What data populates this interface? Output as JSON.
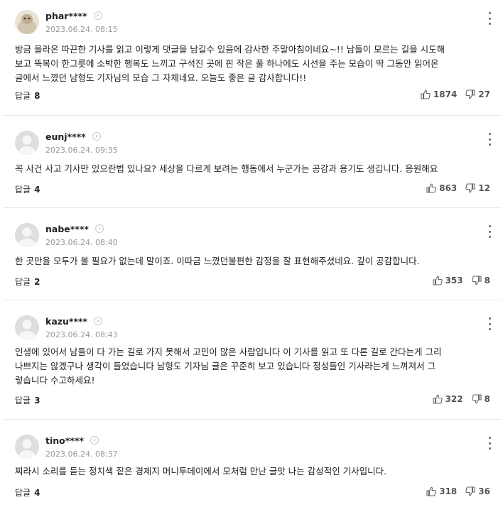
{
  "labels": {
    "reply": "답글"
  },
  "comments": [
    {
      "nickname": "phar****",
      "date": "2023.06.24. 08:15",
      "text": "방금 올라온 따끈한 기사를 읽고 이렇게 댓글을 남길수 있음에 감사한 주말아침이네요~!! 남들이 모르는 길을 시도해\n보고 뚝복이 한그릇에 소박한 행복도 느끼고 구석진 곳에 핀 작은 풀 하나에도 시선을 주는 모습이 딱 그동안 읽어온\n글에서 느꼈던 남형도 기자님의 모습 그 자체네요. 오늘도 좋은 글 감사합니다!!",
      "replies": "8",
      "likes": "1874",
      "dislikes": "27"
    },
    {
      "nickname": "eunj****",
      "date": "2023.06.24. 09:35",
      "text": "꼭 사건 사고 기사만 있으란법 있나요? 세상을 다르게 보려는 행동에서 누군가는 공감과 용기도 생깁니다. 응원해요",
      "replies": "4",
      "likes": "863",
      "dislikes": "12"
    },
    {
      "nickname": "nabe****",
      "date": "2023.06.24. 08:40",
      "text": "한 곳만을 모두가 볼 필요가 없는데 말이죠. 이따금 느꼈던불편한 감정을 잘 표현해주셨네요. 깊이 공감합니다.",
      "replies": "2",
      "likes": "353",
      "dislikes": "8"
    },
    {
      "nickname": "kazu****",
      "date": "2023.06.24. 08:43",
      "text": "인생에 있어서 남들이 다 가는 길로 가지 못해서 고민이 많은 사람입니다 이 기사를 읽고 또 다른 길로 간다는게 그리\n나쁘지는 않겠구나 생각이 들었습니다 남형도 기자님 글은 꾸준히 보고 있습니다 정성들인 기사라는게 느껴져서 그\n렇습니다 수고하세요!",
      "replies": "3",
      "likes": "322",
      "dislikes": "8"
    },
    {
      "nickname": "tino****",
      "date": "2023.06.24. 08:37",
      "text": "찌라시 소리를 듣는 정치색 짙은 경제지 머니투데이에서 모처럼 만난 글맛 나는 감성적인 기사입니다.",
      "replies": "4",
      "likes": "318",
      "dislikes": "36"
    }
  ]
}
